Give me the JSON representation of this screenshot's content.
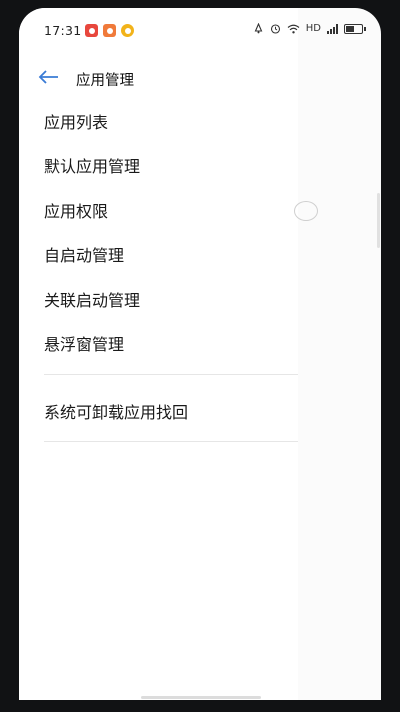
{
  "status_bar": {
    "time": "17:31",
    "network": "HD",
    "battery_level": 0.55,
    "icons": [
      "notification-app-red-icon",
      "notification-app-orange-icon",
      "notification-app-yellow-icon",
      "vibrate-icon",
      "alarm-icon",
      "wifi-icon",
      "signal-icon",
      "battery-icon"
    ],
    "colors": {
      "app1": "#e8473d",
      "app2": "#f07a3a",
      "app3": "#f2b31a"
    }
  },
  "header": {
    "title": "应用管理"
  },
  "menu": {
    "items": [
      {
        "label": "应用列表"
      },
      {
        "label": "默认应用管理"
      },
      {
        "label": "应用权限"
      },
      {
        "label": "自启动管理"
      },
      {
        "label": "关联启动管理"
      },
      {
        "label": "悬浮窗管理"
      }
    ],
    "extra_item": {
      "label": "系统可卸载应用找回"
    }
  },
  "accent": "#3a7bd5"
}
